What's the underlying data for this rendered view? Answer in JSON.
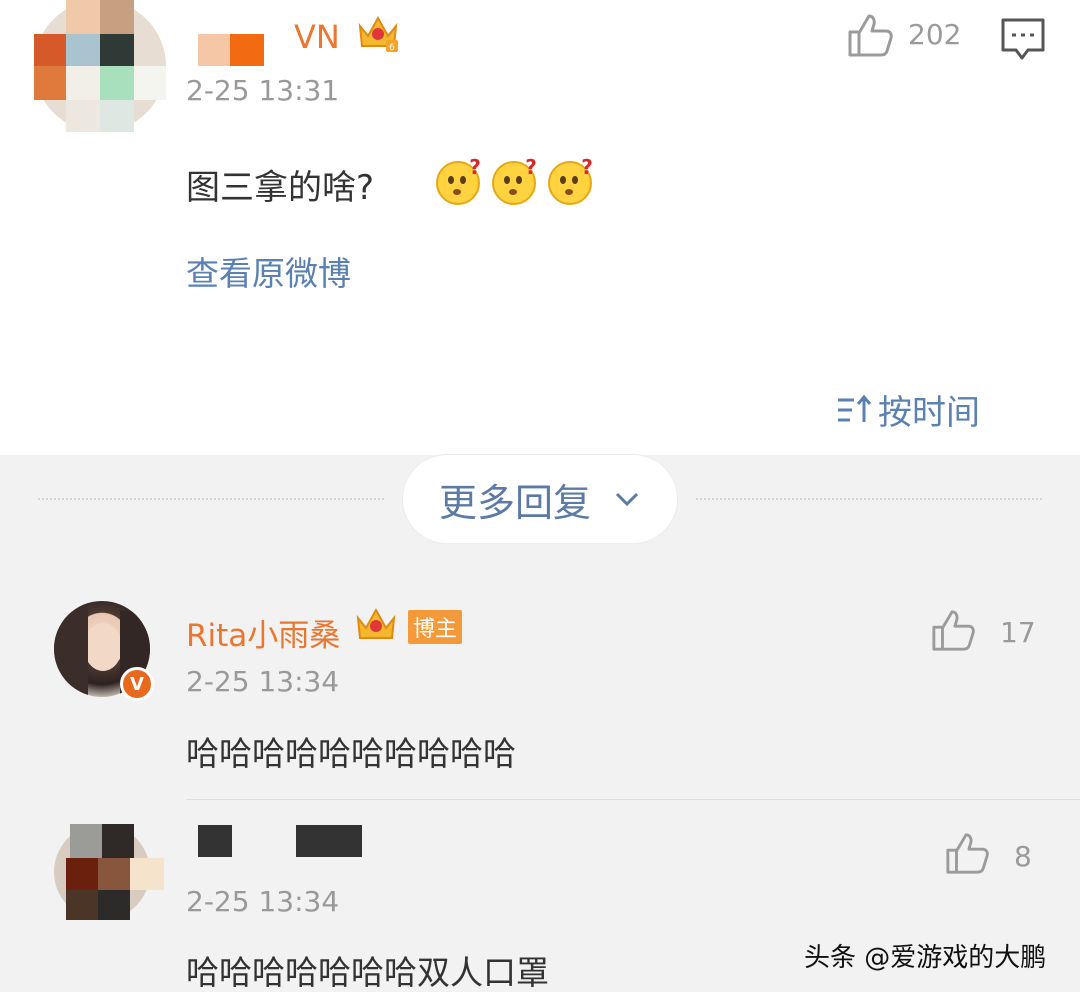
{
  "comment_main": {
    "username": "VN",
    "time": "2-25 13:31",
    "text": "图三拿的啥?",
    "like_count": "202",
    "view_original": "查看原微博"
  },
  "sort": {
    "label": "按时间"
  },
  "more_replies": {
    "label": "更多回复"
  },
  "replies": [
    {
      "username": "Rita小雨桑",
      "badge": "博主",
      "time": "2-25 13:34",
      "text": "哈哈哈哈哈哈哈哈哈哈",
      "like_count": "17"
    },
    {
      "username": "",
      "time": "2-25 13:34",
      "text": "哈哈哈哈哈哈哈双人口罩",
      "like_count": "8"
    }
  ],
  "watermark": "头条 @爱游戏的大鹏",
  "colors": {
    "username": "#e9772f",
    "link": "#5b81b3",
    "badge": "#f49a3b",
    "verified": "#e8691d"
  },
  "icons": [
    "crown-vip-icon",
    "thumbs-up-icon",
    "comment-icon",
    "confused-emoji-icon",
    "sort-icon",
    "chevron-down-icon",
    "verified-v-icon"
  ]
}
